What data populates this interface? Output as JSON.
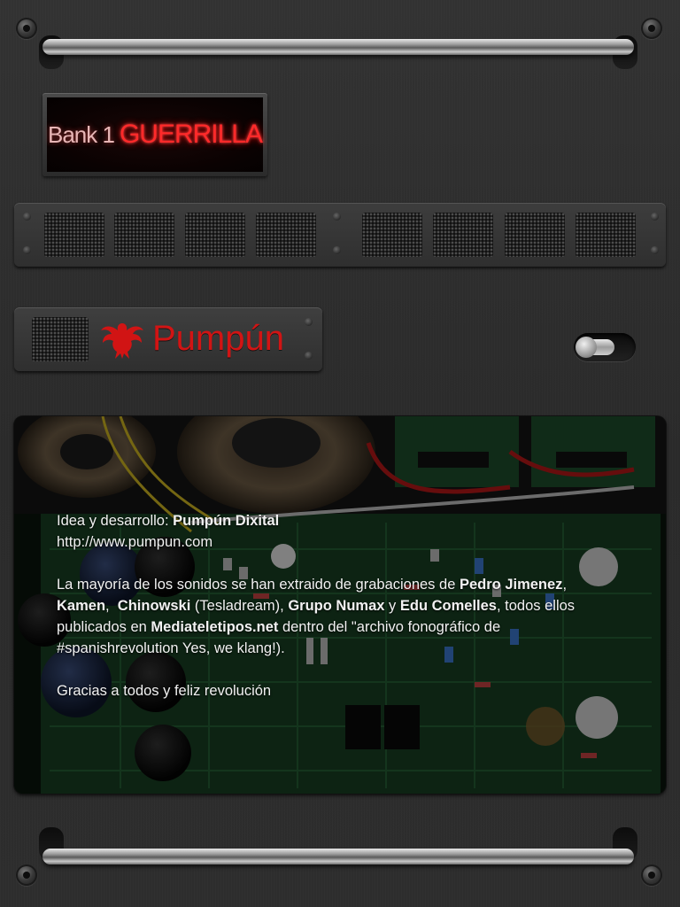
{
  "display": {
    "bank_label": "Bank 1",
    "preset_name": "GUERRILLA",
    "text_color": "#ff2a2a"
  },
  "brand": {
    "logo_icon": "bird-icon",
    "name": "Pumpún",
    "color": "#d11414"
  },
  "toggle": {
    "icon": "toggle-switch-icon"
  },
  "info": {
    "credit_prefix": "Idea y desarrollo: ",
    "credit_name": "Pumpún Dixital",
    "url": "http://www.pumpun.com",
    "p2_a": "La mayoría de los sonidos se han extraido de grabaciones de ",
    "p2_artist1": "Pedro Jimenez",
    "p2_b": ", ",
    "p2_artist2": "Kamen",
    "p2_c": ",  ",
    "p2_artist3": "Chinowski",
    "p2_d": " (Tesladream), ",
    "p2_artist4": "Grupo Numax",
    "p2_e": " y ",
    "p2_artist5": "Edu Comelles",
    "p2_f": ", todos ellos publicados en ",
    "p2_label": "Mediateletipos.net",
    "p2_g": " dentro del \"archivo fonográfico de #spanishrevolution Yes, we klang!).",
    "p3": "Gracias a todos y feliz revolución"
  }
}
